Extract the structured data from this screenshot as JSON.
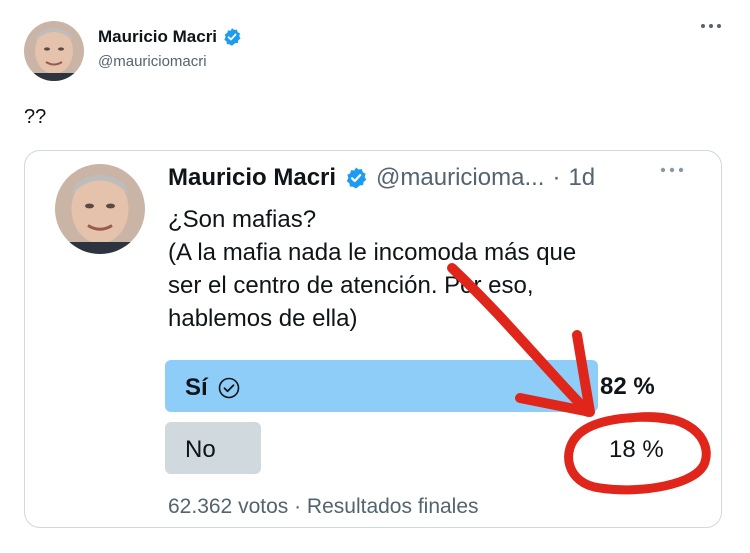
{
  "tweet": {
    "author_name": "Mauricio Macri",
    "author_handle": "@mauriciomacri",
    "text": "??",
    "more_icon": "more-horizontal-icon",
    "verified_icon": "verified-badge-icon"
  },
  "quoted_tweet": {
    "author_name": "Mauricio Macri",
    "author_handle": "@mauricioma...",
    "separator": "·",
    "time": "1d",
    "text_lines": [
      "¿Son mafias?",
      "(A la mafia nada le incomoda más que",
      "ser el centro de atención. Por eso,",
      "hablemos de ella)"
    ]
  },
  "poll": {
    "options": [
      {
        "label": "Sí",
        "percent_text": "82 %",
        "percent": 82,
        "selected": true,
        "color": "#8ecdf7"
      },
      {
        "label": "No",
        "percent_text": "18 %",
        "percent": 18,
        "selected": false,
        "color": "#cfd9de"
      }
    ],
    "footer": "62.362 votos · Resultados finales"
  },
  "annotation": {
    "color": "#e0261b"
  },
  "colors": {
    "verified": "#1d9bf0",
    "secondary_text": "#536471",
    "border": "#cfd9de"
  }
}
